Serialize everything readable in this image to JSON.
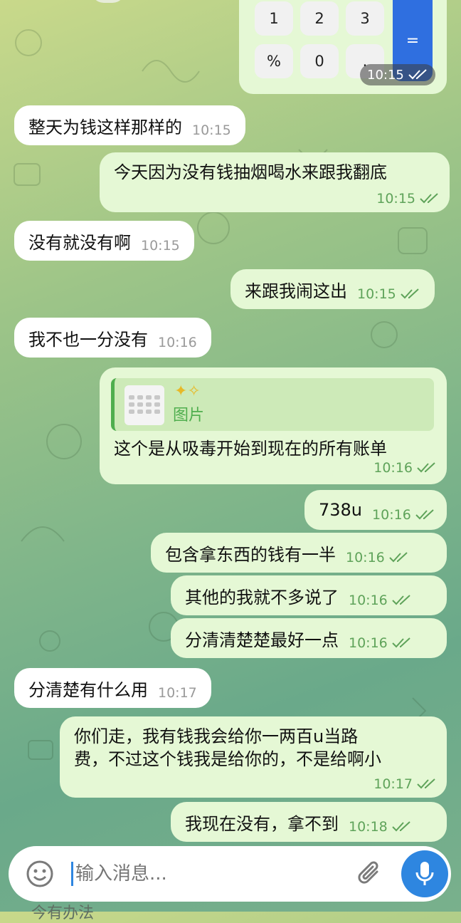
{
  "calculator": {
    "keys": [
      "1",
      "2",
      "3",
      "%",
      "0",
      "."
    ],
    "equals_label": "=",
    "time": "10:15"
  },
  "messages": [
    {
      "dir": "in",
      "text": "整天为钱这样那样的",
      "time": "10:15"
    },
    {
      "dir": "out",
      "text": "今天因为没有钱抽烟喝水来跟我翻底",
      "time": "10:15"
    },
    {
      "dir": "in",
      "text": "没有就没有啊",
      "time": "10:15"
    },
    {
      "dir": "out",
      "text": "来跟我闹这出",
      "time": "10:15"
    },
    {
      "dir": "in",
      "text": "我不也一分没有",
      "time": "10:16"
    },
    {
      "dir": "out",
      "reply_label": "图片",
      "text": "这个是从吸毒开始到现在的所有账单",
      "time": "10:16"
    },
    {
      "dir": "out",
      "text": "738u",
      "time": "10:16"
    },
    {
      "dir": "out",
      "text": "包含拿东西的钱有一半",
      "time": "10:16"
    },
    {
      "dir": "out",
      "text": "其他的我就不多说了",
      "time": "10:16"
    },
    {
      "dir": "out",
      "text": "分清清楚楚最好一点",
      "time": "10:16"
    },
    {
      "dir": "in",
      "text": "分清楚有什么用",
      "time": "10:17"
    },
    {
      "dir": "out",
      "lines": [
        "你们走，我有钱我会给你一两百u当路",
        "费，不过这个钱我是给你的，不是给啊小"
      ],
      "time": "10:17"
    },
    {
      "dir": "out",
      "text": "我现在没有，拿不到",
      "time": "10:18"
    }
  ],
  "composer": {
    "placeholder": "输入消息...",
    "emoji_icon": "smiley-icon",
    "attach_icon": "paperclip-icon",
    "mic_icon": "microphone-icon"
  },
  "bottom_partial_text": "今有办法",
  "colors": {
    "incoming": "#ffffff",
    "outgoing": "#e5f8d5",
    "accent": "#4fae4e",
    "mic": "#2e86e0"
  }
}
